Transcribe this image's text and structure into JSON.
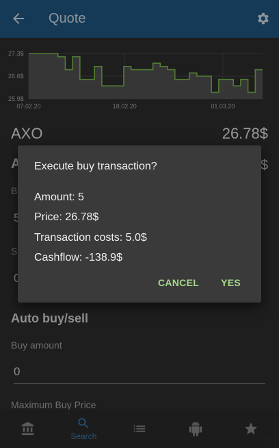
{
  "appbar": {
    "title": "Quote",
    "color": "#215a86"
  },
  "chart_data": {
    "type": "line",
    "y_tick_labels": [
      "27.3$",
      "26.6$",
      "25.9$"
    ],
    "x_tick_labels": [
      "07.02.20",
      "18.02.20",
      "01.03.20"
    ],
    "ylim": [
      25.9,
      27.3
    ],
    "grid": true,
    "line_color": "#7fbf4d",
    "fill_color": "#5a5a5a",
    "values": [
      27.3,
      27.3,
      27.3,
      27.3,
      27.2,
      26.8,
      27.2,
      26.5,
      26.5,
      26.9,
      26.3,
      26.3,
      26.3,
      26.9,
      26.8,
      26.8,
      26.8,
      27.0,
      26.9,
      26.8,
      26.5,
      26.5,
      26.7,
      26.6,
      26.6,
      26.1,
      26.5,
      26.5,
      26.3,
      26.5,
      26.1,
      26.8
    ]
  },
  "quote": {
    "symbol": "AXO",
    "price": "26.78$"
  },
  "background": {
    "heading_left": "A",
    "heading_right": "$",
    "label1": "B",
    "input1": "5",
    "label2": "S",
    "input2": "0"
  },
  "dialog": {
    "title": "Execute buy transaction?",
    "amount": "Amount: 5",
    "price": "Price: 26.78$",
    "costs": "Transaction costs: 5.0$",
    "cashflow": "Cashflow: -138.9$",
    "cancel": "CANCEL",
    "yes": "YES",
    "button_color": "#a5d88c"
  },
  "auto": {
    "title": "Auto buy/sell",
    "buy_amount_label": "Buy amount",
    "buy_amount_value": "0",
    "max_price_label": "Maximum Buy Price"
  },
  "nav": {
    "items": [
      {
        "icon": "bank-icon",
        "label": ""
      },
      {
        "icon": "search-icon",
        "label": "Search"
      },
      {
        "icon": "list-icon",
        "label": ""
      },
      {
        "icon": "android-icon",
        "label": ""
      },
      {
        "icon": "star-icon",
        "label": ""
      }
    ],
    "active_color": "#3b7fb8",
    "inactive_color": "#8a8a8a"
  }
}
